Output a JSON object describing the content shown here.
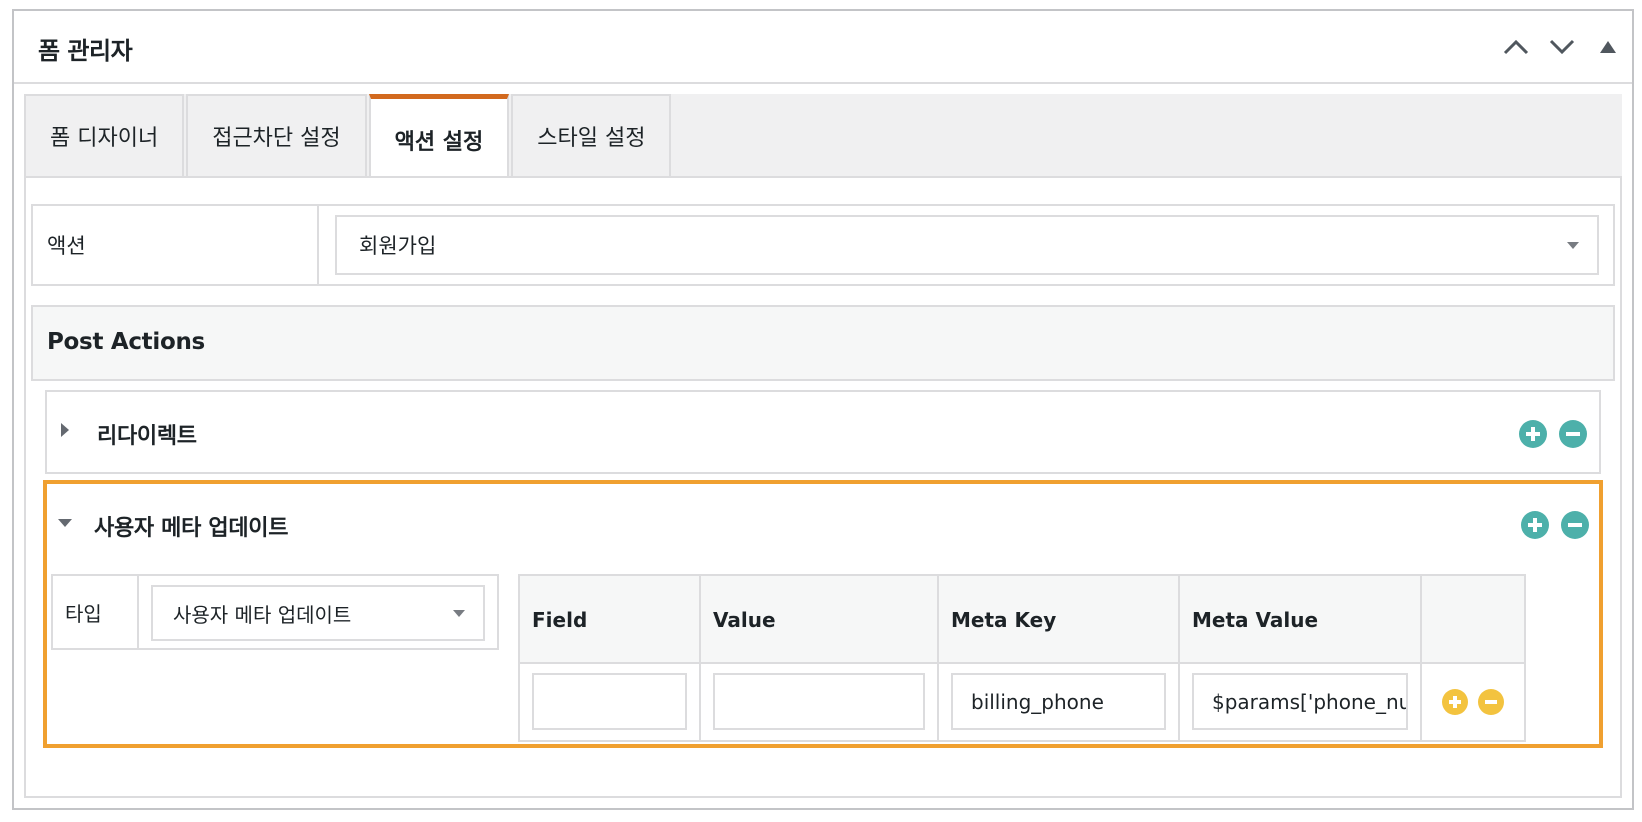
{
  "panel": {
    "title": "폼 관리자",
    "controls": [
      "chevron-up-icon",
      "chevron-down-icon",
      "triangle-up-icon"
    ]
  },
  "tabs": [
    {
      "label": "폼 디자이너",
      "active": false
    },
    {
      "label": "접근차단 설정",
      "active": false
    },
    {
      "label": "액션 설정",
      "active": true
    },
    {
      "label": "스타일 설정",
      "active": false
    }
  ],
  "action": {
    "label": "액션",
    "selected": "회원가입"
  },
  "post_actions": {
    "title": "Post Actions",
    "items": [
      {
        "title": "리다이렉트",
        "expanded": false
      },
      {
        "title": "사용자 메타 업데이트",
        "expanded": true
      }
    ]
  },
  "meta_update": {
    "type_label": "타입",
    "type_selected": "사용자 메타 업데이트",
    "columns": [
      "Field",
      "Value",
      "Meta Key",
      "Meta Value"
    ],
    "rows": [
      {
        "field": "",
        "value": "",
        "meta_key": "billing_phone",
        "meta_value": "$params['phone_num"
      }
    ]
  },
  "colors": {
    "active_tab_accent": "#d2691e",
    "highlight_border": "#f0a030",
    "teal_button": "#4db0aa",
    "gold_button": "#f3c33f"
  }
}
